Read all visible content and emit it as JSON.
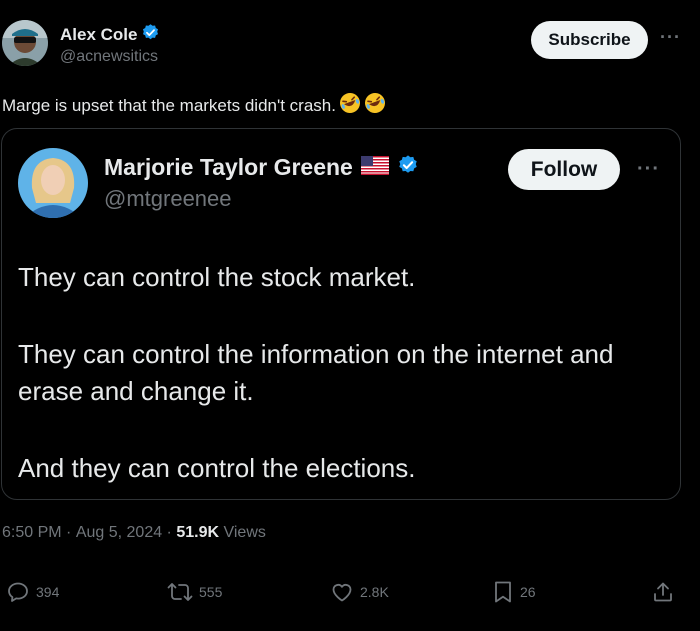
{
  "post": {
    "author": {
      "name": "Alex Cole",
      "handle": "@acnewsitics",
      "verified": true
    },
    "subscribe_label": "Subscribe",
    "more_label": "···",
    "text": "Marge is upset that the markets didn't crash.",
    "emoji": [
      "rolling-on-the-floor-laughing",
      "rolling-on-the-floor-laughing"
    ]
  },
  "quote": {
    "author": {
      "name": "Marjorie Taylor Greene",
      "flag": "🇺🇸",
      "handle": "@mtgreenee",
      "verified": true
    },
    "follow_label": "Follow",
    "more_label": "···",
    "lines": [
      "They can control the stock market.",
      "They can control the information on the internet and",
      "erase and change it.",
      "And they can control the elections."
    ]
  },
  "meta": {
    "time": "6:50 PM",
    "separator": " · ",
    "date": "Aug 5, 2024",
    "views_count": "51.9K",
    "views_label": " Views"
  },
  "actions": {
    "replies": "394",
    "reposts": "555",
    "likes": "2.8K",
    "bookmarks": "26"
  },
  "colors": {
    "background": "#000000",
    "text": "#e7e9ea",
    "muted": "#71767b",
    "verified": "#1d9bf0",
    "button": "#eff3f4",
    "border": "#2f3336"
  },
  "icons": {
    "verified": "verified-badge-icon",
    "reply": "speech-bubble-icon",
    "repost": "repost-arrows-icon",
    "like": "heart-icon",
    "bookmark": "bookmark-icon",
    "share": "share-upload-icon",
    "more": "more-dots-icon"
  }
}
